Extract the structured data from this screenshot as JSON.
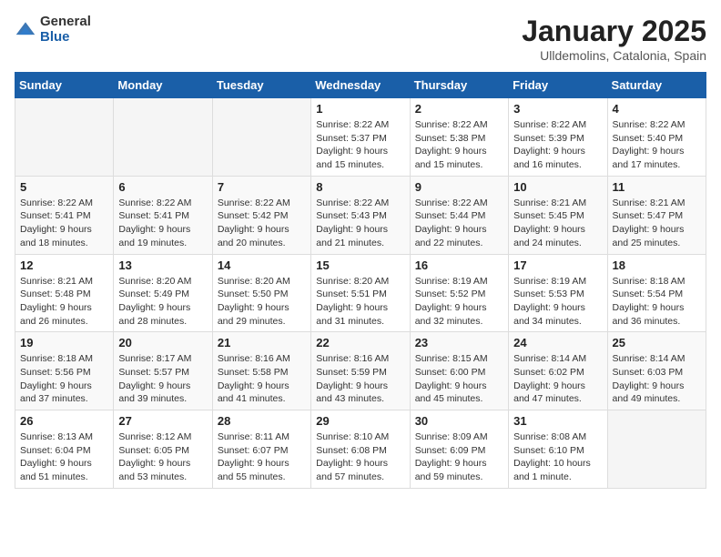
{
  "logo": {
    "general": "General",
    "blue": "Blue"
  },
  "header": {
    "title": "January 2025",
    "location": "Ulldemolins, Catalonia, Spain"
  },
  "days_of_week": [
    "Sunday",
    "Monday",
    "Tuesday",
    "Wednesday",
    "Thursday",
    "Friday",
    "Saturday"
  ],
  "weeks": [
    [
      {
        "day": "",
        "sunrise": "",
        "sunset": "",
        "daylight": ""
      },
      {
        "day": "",
        "sunrise": "",
        "sunset": "",
        "daylight": ""
      },
      {
        "day": "",
        "sunrise": "",
        "sunset": "",
        "daylight": ""
      },
      {
        "day": "1",
        "sunrise": "Sunrise: 8:22 AM",
        "sunset": "Sunset: 5:37 PM",
        "daylight": "Daylight: 9 hours and 15 minutes."
      },
      {
        "day": "2",
        "sunrise": "Sunrise: 8:22 AM",
        "sunset": "Sunset: 5:38 PM",
        "daylight": "Daylight: 9 hours and 15 minutes."
      },
      {
        "day": "3",
        "sunrise": "Sunrise: 8:22 AM",
        "sunset": "Sunset: 5:39 PM",
        "daylight": "Daylight: 9 hours and 16 minutes."
      },
      {
        "day": "4",
        "sunrise": "Sunrise: 8:22 AM",
        "sunset": "Sunset: 5:40 PM",
        "daylight": "Daylight: 9 hours and 17 minutes."
      }
    ],
    [
      {
        "day": "5",
        "sunrise": "Sunrise: 8:22 AM",
        "sunset": "Sunset: 5:41 PM",
        "daylight": "Daylight: 9 hours and 18 minutes."
      },
      {
        "day": "6",
        "sunrise": "Sunrise: 8:22 AM",
        "sunset": "Sunset: 5:41 PM",
        "daylight": "Daylight: 9 hours and 19 minutes."
      },
      {
        "day": "7",
        "sunrise": "Sunrise: 8:22 AM",
        "sunset": "Sunset: 5:42 PM",
        "daylight": "Daylight: 9 hours and 20 minutes."
      },
      {
        "day": "8",
        "sunrise": "Sunrise: 8:22 AM",
        "sunset": "Sunset: 5:43 PM",
        "daylight": "Daylight: 9 hours and 21 minutes."
      },
      {
        "day": "9",
        "sunrise": "Sunrise: 8:22 AM",
        "sunset": "Sunset: 5:44 PM",
        "daylight": "Daylight: 9 hours and 22 minutes."
      },
      {
        "day": "10",
        "sunrise": "Sunrise: 8:21 AM",
        "sunset": "Sunset: 5:45 PM",
        "daylight": "Daylight: 9 hours and 24 minutes."
      },
      {
        "day": "11",
        "sunrise": "Sunrise: 8:21 AM",
        "sunset": "Sunset: 5:47 PM",
        "daylight": "Daylight: 9 hours and 25 minutes."
      }
    ],
    [
      {
        "day": "12",
        "sunrise": "Sunrise: 8:21 AM",
        "sunset": "Sunset: 5:48 PM",
        "daylight": "Daylight: 9 hours and 26 minutes."
      },
      {
        "day": "13",
        "sunrise": "Sunrise: 8:20 AM",
        "sunset": "Sunset: 5:49 PM",
        "daylight": "Daylight: 9 hours and 28 minutes."
      },
      {
        "day": "14",
        "sunrise": "Sunrise: 8:20 AM",
        "sunset": "Sunset: 5:50 PM",
        "daylight": "Daylight: 9 hours and 29 minutes."
      },
      {
        "day": "15",
        "sunrise": "Sunrise: 8:20 AM",
        "sunset": "Sunset: 5:51 PM",
        "daylight": "Daylight: 9 hours and 31 minutes."
      },
      {
        "day": "16",
        "sunrise": "Sunrise: 8:19 AM",
        "sunset": "Sunset: 5:52 PM",
        "daylight": "Daylight: 9 hours and 32 minutes."
      },
      {
        "day": "17",
        "sunrise": "Sunrise: 8:19 AM",
        "sunset": "Sunset: 5:53 PM",
        "daylight": "Daylight: 9 hours and 34 minutes."
      },
      {
        "day": "18",
        "sunrise": "Sunrise: 8:18 AM",
        "sunset": "Sunset: 5:54 PM",
        "daylight": "Daylight: 9 hours and 36 minutes."
      }
    ],
    [
      {
        "day": "19",
        "sunrise": "Sunrise: 8:18 AM",
        "sunset": "Sunset: 5:56 PM",
        "daylight": "Daylight: 9 hours and 37 minutes."
      },
      {
        "day": "20",
        "sunrise": "Sunrise: 8:17 AM",
        "sunset": "Sunset: 5:57 PM",
        "daylight": "Daylight: 9 hours and 39 minutes."
      },
      {
        "day": "21",
        "sunrise": "Sunrise: 8:16 AM",
        "sunset": "Sunset: 5:58 PM",
        "daylight": "Daylight: 9 hours and 41 minutes."
      },
      {
        "day": "22",
        "sunrise": "Sunrise: 8:16 AM",
        "sunset": "Sunset: 5:59 PM",
        "daylight": "Daylight: 9 hours and 43 minutes."
      },
      {
        "day": "23",
        "sunrise": "Sunrise: 8:15 AM",
        "sunset": "Sunset: 6:00 PM",
        "daylight": "Daylight: 9 hours and 45 minutes."
      },
      {
        "day": "24",
        "sunrise": "Sunrise: 8:14 AM",
        "sunset": "Sunset: 6:02 PM",
        "daylight": "Daylight: 9 hours and 47 minutes."
      },
      {
        "day": "25",
        "sunrise": "Sunrise: 8:14 AM",
        "sunset": "Sunset: 6:03 PM",
        "daylight": "Daylight: 9 hours and 49 minutes."
      }
    ],
    [
      {
        "day": "26",
        "sunrise": "Sunrise: 8:13 AM",
        "sunset": "Sunset: 6:04 PM",
        "daylight": "Daylight: 9 hours and 51 minutes."
      },
      {
        "day": "27",
        "sunrise": "Sunrise: 8:12 AM",
        "sunset": "Sunset: 6:05 PM",
        "daylight": "Daylight: 9 hours and 53 minutes."
      },
      {
        "day": "28",
        "sunrise": "Sunrise: 8:11 AM",
        "sunset": "Sunset: 6:07 PM",
        "daylight": "Daylight: 9 hours and 55 minutes."
      },
      {
        "day": "29",
        "sunrise": "Sunrise: 8:10 AM",
        "sunset": "Sunset: 6:08 PM",
        "daylight": "Daylight: 9 hours and 57 minutes."
      },
      {
        "day": "30",
        "sunrise": "Sunrise: 8:09 AM",
        "sunset": "Sunset: 6:09 PM",
        "daylight": "Daylight: 9 hours and 59 minutes."
      },
      {
        "day": "31",
        "sunrise": "Sunrise: 8:08 AM",
        "sunset": "Sunset: 6:10 PM",
        "daylight": "Daylight: 10 hours and 1 minute."
      },
      {
        "day": "",
        "sunrise": "",
        "sunset": "",
        "daylight": ""
      }
    ]
  ]
}
